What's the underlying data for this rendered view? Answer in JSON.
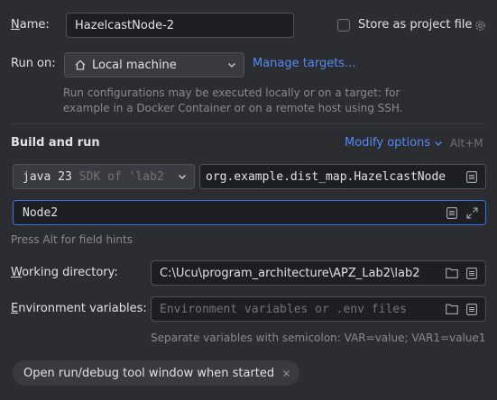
{
  "name": {
    "label_mnemonic": "N",
    "label_rest": "ame:",
    "value": "HazelcastNode-2"
  },
  "store_as_project_file": {
    "label": "Store as project file",
    "checked": false
  },
  "run_on": {
    "label": "Run on:",
    "target": "Local machine",
    "manage_link": "Manage targets..."
  },
  "run_on_hint": {
    "line1": "Run configurations may be executed locally or on a target: for",
    "line2": "example in a Docker Container or on a remote host using SSH."
  },
  "build_and_run": {
    "title": "Build and run",
    "modify_options": "Modify options",
    "shortcut": "Alt+M"
  },
  "jdk": {
    "version": "java 23",
    "detail": "SDK of 'lab2"
  },
  "main_class": {
    "value": "org.example.dist_map.HazelcastNode"
  },
  "program_args": {
    "value": "Node2"
  },
  "field_hint": "Press Alt for field hints",
  "working_directory": {
    "label_mnemonic": "W",
    "label_rest": "orking directory:",
    "value": "C:\\Ucu\\program_architecture\\APZ_Lab2\\lab2"
  },
  "env_vars": {
    "label_mnemonic": "E",
    "label_rest": "nvironment variables:",
    "placeholder": "Environment variables or .env files",
    "hint": "Separate variables with semicolon: VAR=value; VAR1=value1"
  },
  "open_tool_window_chip": {
    "label": "Open run/debug tool window when started"
  },
  "colors": {
    "background": "#2b2d30",
    "field": "#1e1f22",
    "border": "#4e5157",
    "link": "#548af7",
    "focus": "#3574f0"
  }
}
